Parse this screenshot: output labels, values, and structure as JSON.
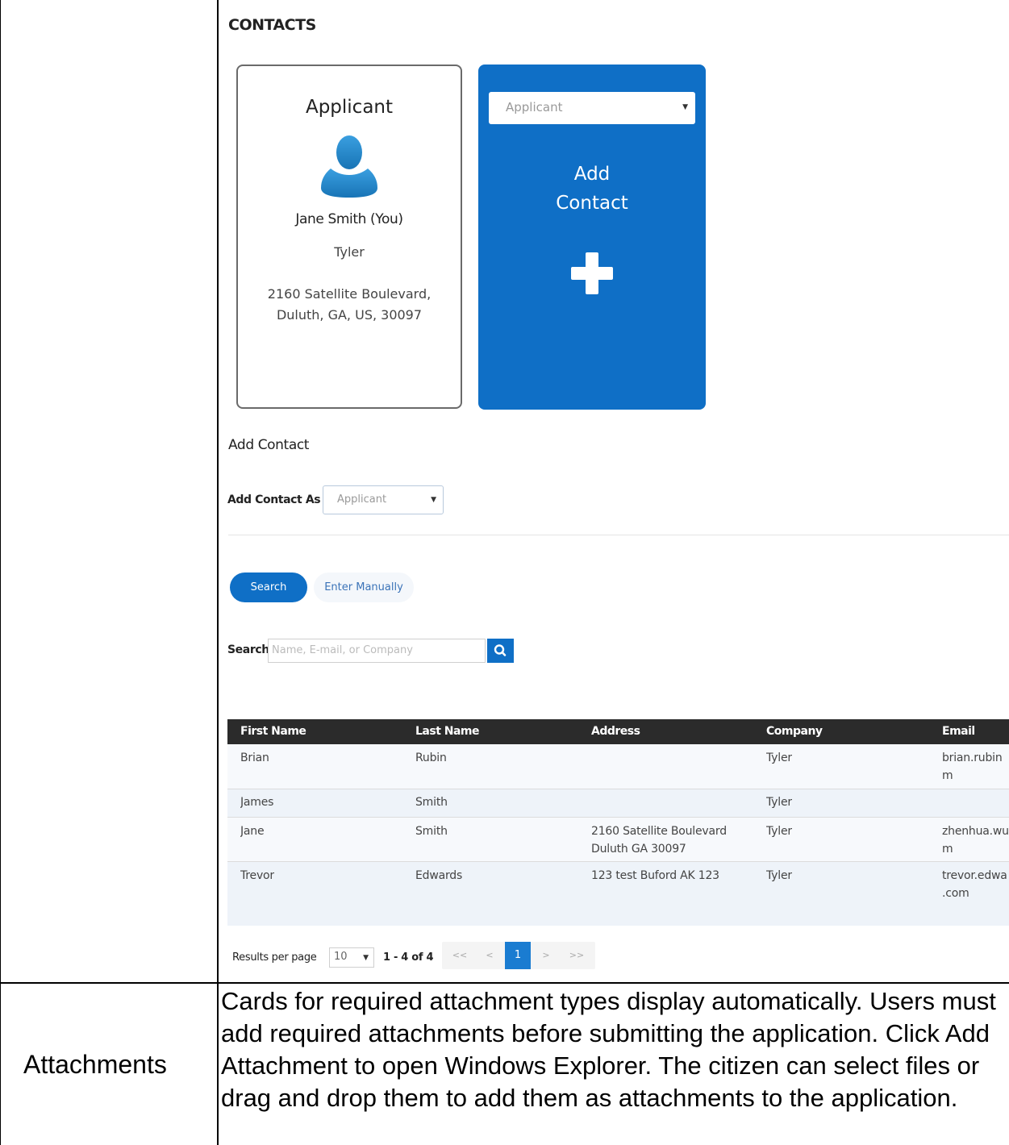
{
  "contacts": {
    "section_title": "CONTACTS",
    "applicant_card": {
      "role": "Applicant",
      "name": "Jane Smith (You)",
      "company": "Tyler",
      "address_line1": "2160 Satellite Boulevard,",
      "address_line2": "Duluth, GA, US, 30097"
    },
    "add_card": {
      "select_value": "Applicant",
      "label_line1": "Add",
      "label_line2": "Contact",
      "accent_color": "#0f6fc6"
    },
    "add_contact_heading": "Add Contact",
    "add_contact_as_label": "Add Contact As",
    "add_contact_as_value": "Applicant",
    "search_button": "Search",
    "enter_manually_button": "Enter Manually",
    "search_label": "Search",
    "search_placeholder": "Name, E-mail, or Company",
    "table": {
      "headers": [
        "First Name",
        "Last Name",
        "Address",
        "Company",
        "Email"
      ],
      "rows": [
        {
          "first": "Brian",
          "last": "Rubin",
          "address1": "",
          "address2": "",
          "company": "Tyler",
          "email1": "brian.rubin",
          "email2": "m"
        },
        {
          "first": "James",
          "last": "Smith",
          "address1": "",
          "address2": "",
          "company": "Tyler",
          "email1": "",
          "email2": ""
        },
        {
          "first": "Jane",
          "last": "Smith",
          "address1": "2160 Satellite Boulevard",
          "address2": "Duluth GA 30097",
          "company": "Tyler",
          "email1": "zhenhua.wu",
          "email2": "m"
        },
        {
          "first": "Trevor",
          "last": "Edwards",
          "address1": "123 test Buford AK 123",
          "address2": "",
          "company": "Tyler",
          "email1": "trevor.edwa",
          "email2": ".com"
        }
      ]
    },
    "pager": {
      "results_per_page_label": "Results per page",
      "per_page_value": "10",
      "range_text": "1 - 4 of 4",
      "first": "<<",
      "prev": "<",
      "current": "1",
      "next": ">",
      "last": ">>"
    }
  },
  "attachments_row": {
    "label": "Attachments",
    "description": "Cards for required attachment types display automatically. Users must add required attachments before submitting the application. Click Add Attachment to open Windows Explorer. The citizen can select files or drag and drop them to add them as attachments to the application."
  }
}
